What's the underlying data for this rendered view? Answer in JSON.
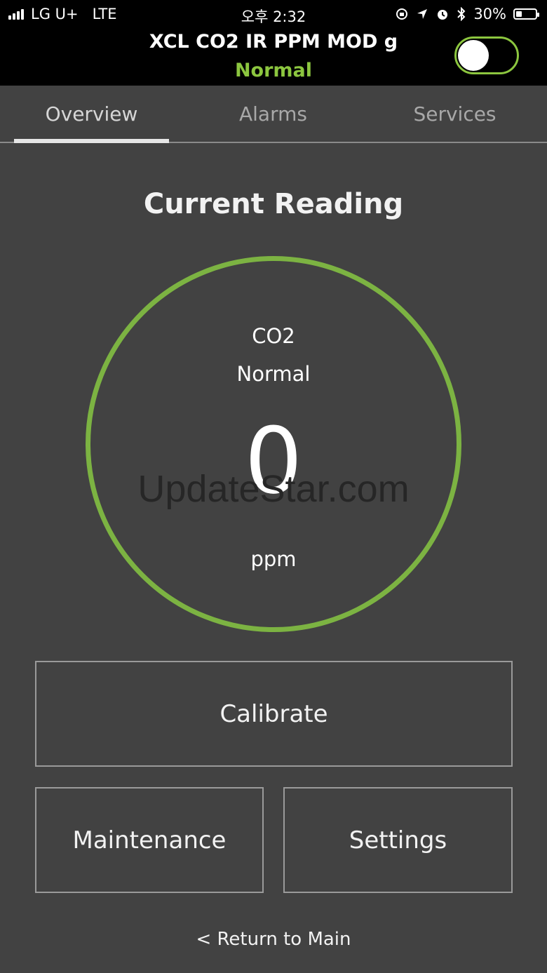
{
  "status_bar": {
    "carrier": "LG U+",
    "network": "LTE",
    "time": "오후 2:32",
    "battery": "30%",
    "battery_level": 0.3,
    "icons": [
      "signal-icon",
      "lock-rotation-icon",
      "location-icon",
      "alarm-icon",
      "bluetooth-icon",
      "battery-icon"
    ]
  },
  "header": {
    "title": "XCL CO2 IR PPM MOD g",
    "status": "Normal",
    "status_color": "#8cc63f",
    "toggle_on": true
  },
  "tabs": [
    {
      "label": "Overview",
      "active": true
    },
    {
      "label": "Alarms",
      "active": false
    },
    {
      "label": "Services",
      "active": false
    }
  ],
  "main": {
    "heading": "Current Reading",
    "gauge": {
      "gas": "CO2",
      "state": "Normal",
      "value": "0",
      "unit": "ppm",
      "ring_color": "#7cb342"
    },
    "watermark": "UpdateStar.com"
  },
  "actions": {
    "calibrate": "Calibrate",
    "maintenance": "Maintenance",
    "settings": "Settings"
  },
  "footer": {
    "return_label": "< Return to Main"
  }
}
